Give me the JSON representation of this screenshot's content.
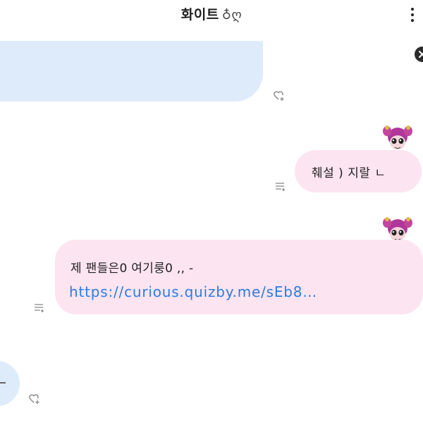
{
  "header": {
    "title": "화이트",
    "title_emoji": "♁ღ",
    "more_icon": "vertical-ellipsis-icon"
  },
  "messages": [
    {
      "side": "received",
      "text": ""
    },
    {
      "side": "sent",
      "text": "췌설 ) 지랄 ㄴ"
    },
    {
      "side": "sent",
      "text": "제 팬들은0 여기룽0 ,, -",
      "link": "https://curious.quizby.me/sEb8…"
    },
    {
      "side": "received",
      "text": "-"
    }
  ],
  "colors": {
    "sent_bubble": "#fce4f0",
    "received_bubble": "#deebfb",
    "link": "#2a7de1"
  },
  "icons": {
    "reaction": "heart-plus-icon",
    "reply_menu": "reply-list-icon",
    "close": "close-icon",
    "avatar": "pink-character-avatar"
  }
}
